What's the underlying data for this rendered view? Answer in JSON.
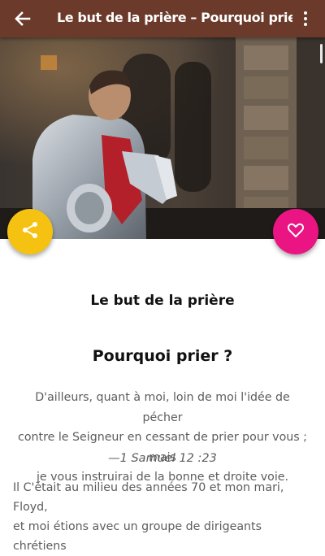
{
  "appbar": {
    "title": "Le but de la prière – Pourquoi prier ?",
    "back_icon": "arrow-back-icon",
    "menu_icon": "more-vert-icon",
    "color": "#6b3a2a"
  },
  "hero": {
    "image_alt": "knight-in-armor-praying-image"
  },
  "fabs": {
    "share": {
      "icon": "share-icon",
      "color": "#f5c211"
    },
    "favorite": {
      "icon": "heart-outline-icon",
      "color": "#ea1583"
    }
  },
  "article": {
    "heading": "Le but de la prière",
    "subheading": "Pourquoi prier ?",
    "verse_lines": [
      "D'ailleurs, quant à moi, loin de moi l'idée de pécher",
      "contre le Seigneur en cessant de prier pour vous ; mais",
      "je vous instruirai de la bonne et droite voie."
    ],
    "verse_reference": "—1 Samuel 12 :23",
    "body_lines": [
      "Il C'était au milieu des années 70 et mon mari, Floyd,",
      "et moi étions avec un groupe de dirigeants chrétiens"
    ]
  }
}
